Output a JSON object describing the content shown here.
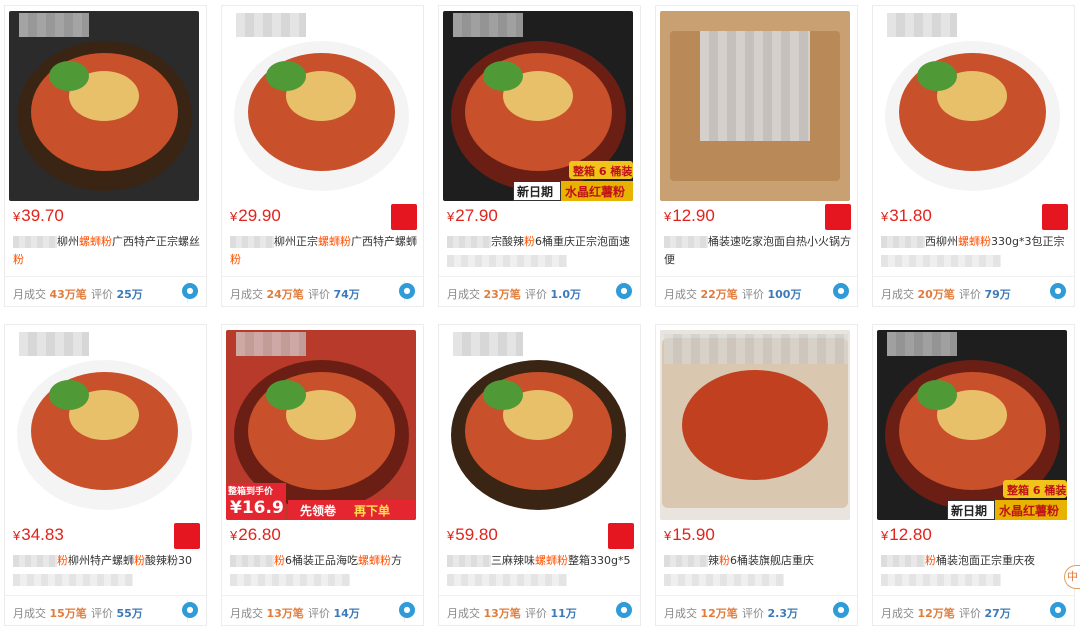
{
  "currency": "¥",
  "labels": {
    "sold": "月成交",
    "reviews": "评价"
  },
  "products": [
    {
      "price": "39.70",
      "title_pre": "柳州",
      "kw1": "螺蛳粉",
      "title_mid": "广西特产正宗螺丝",
      "kw2": "粉",
      "title_post": "",
      "sold": "43万笔",
      "reviews": "25万",
      "shop_badge": false,
      "image_style": "dark-bowl"
    },
    {
      "price": "29.90",
      "title_pre": "柳州正宗",
      "kw1": "螺蛳粉",
      "title_mid": "广西特产螺蛳",
      "kw2": "粉",
      "title_post": "",
      "sold": "24万笔",
      "reviews": "74万",
      "shop_badge": true,
      "image_style": "white-bowl"
    },
    {
      "price": "27.90",
      "title_pre": "",
      "kw1": "",
      "title_mid": "宗酸辣",
      "kw2": "粉",
      "title_post": "6桶重庆正宗泡面速",
      "sold": "23万笔",
      "reviews": "1.0万",
      "shop_badge": false,
      "image_style": "red-bowl",
      "promo1": "整箱 6 桶装",
      "promo2": "新日期",
      "promo3": "水晶红薯粉"
    },
    {
      "price": "12.90",
      "title_pre": "",
      "kw1": "",
      "title_mid": "桶装速吃家泡面自热小火锅方便",
      "kw2": "",
      "title_post": "",
      "sold": "22万笔",
      "reviews": "100万",
      "shop_badge": true,
      "image_style": "box"
    },
    {
      "price": "31.80",
      "title_pre": "",
      "kw1": "",
      "title_mid": "西柳州",
      "kw2": "螺蛳粉",
      "title_post": "330g*3包正宗",
      "sold": "20万笔",
      "reviews": "79万",
      "shop_badge": true,
      "image_style": "white-bowl-2"
    },
    {
      "price": "34.83",
      "title_pre": "",
      "kw1": "粉",
      "title_mid": "柳州特产螺蛳",
      "kw2": "粉",
      "title_post": "酸辣粉30",
      "sold": "15万笔",
      "reviews": "55万",
      "shop_badge": true,
      "image_style": "white-bowl-3"
    },
    {
      "price": "26.80",
      "title_pre": "",
      "kw1": "粉",
      "title_mid": "6桶装正品海吃",
      "kw2": "螺蛳粉",
      "title_post": "方",
      "sold": "13万笔",
      "reviews": "14万",
      "shop_badge": false,
      "image_style": "red-bowl-2",
      "promo1": "整箱到手价",
      "promo2": "16.9",
      "promo3": "先领卷",
      "promo4": "再下单"
    },
    {
      "price": "59.80",
      "title_pre": "",
      "kw1": "",
      "title_mid": "三麻辣味",
      "kw2": "螺蛳粉",
      "title_post": "整箱330g*5",
      "sold": "13万笔",
      "reviews": "11万",
      "shop_badge": true,
      "image_style": "dark-bowl-2"
    },
    {
      "price": "15.90",
      "title_pre": "",
      "kw1": "",
      "title_mid": "辣",
      "kw2": "粉",
      "title_post": "6桶装旗舰店重庆",
      "sold": "12万笔",
      "reviews": "2.3万",
      "shop_badge": false,
      "image_style": "box-bowl"
    },
    {
      "price": "12.80",
      "title_pre": "",
      "kw1": "",
      "title_mid": "",
      "kw2": "粉",
      "title_post": "桶装泡面正宗重庆夜",
      "sold": "12万笔",
      "reviews": "27万",
      "shop_badge": false,
      "image_style": "red-bowl-3",
      "promo1": "整箱 6 桶装",
      "promo2": "新日期",
      "promo3": "水晶红薯粉"
    }
  ],
  "side_float": "中",
  "colors": {
    "price": "#e0231b",
    "keyword": "#ff5000",
    "sold_value": "#e07c3c",
    "review_value": "#3d7ab8"
  }
}
